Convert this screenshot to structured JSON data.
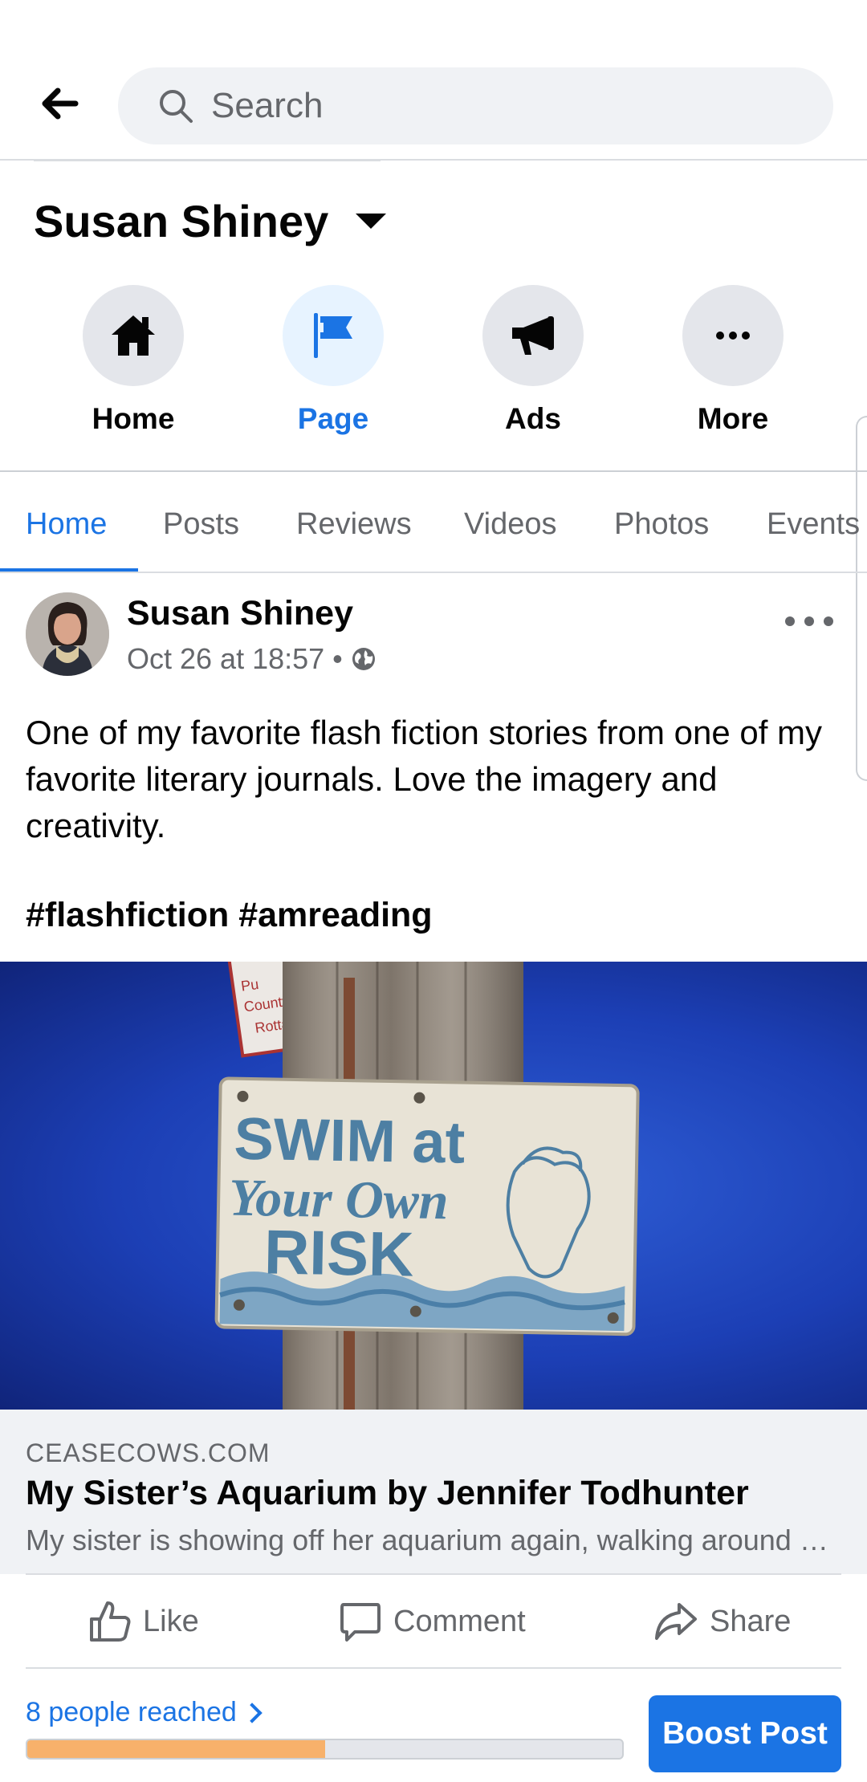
{
  "search": {
    "placeholder": "Search"
  },
  "page": {
    "title": "Susan Shiney"
  },
  "nav": [
    {
      "label": "Home",
      "icon": "home-icon",
      "active": false
    },
    {
      "label": "Page",
      "icon": "flag-icon",
      "active": true
    },
    {
      "label": "Ads",
      "icon": "megaphone-icon",
      "active": false
    },
    {
      "label": "More",
      "icon": "more-icon",
      "active": false
    }
  ],
  "tabs": [
    {
      "label": "Home",
      "active": true
    },
    {
      "label": "Posts"
    },
    {
      "label": "Reviews"
    },
    {
      "label": "Videos"
    },
    {
      "label": "Photos"
    },
    {
      "label": "Events"
    }
  ],
  "post": {
    "author": "Susan Shiney",
    "timestamp": "Oct 26 at 18:57",
    "separator": "•",
    "text": "One of my favorite flash fiction stories from one of my favorite literary journals. Love the imagery and creativity.",
    "hashtags": "#flashfiction #amreading",
    "image": {
      "sign_line1": "SWIM at",
      "sign_line2": "Your Own",
      "sign_line3": "RISK"
    },
    "link": {
      "domain": "CEASECOWS.COM",
      "title": "My Sister’s Aquarium by Jennifer Todhunter",
      "description": "My sister is showing off her aquarium again, walking around with it strapped to her head"
    }
  },
  "actions": {
    "like": "Like",
    "comment": "Comment",
    "share": "Share"
  },
  "footer": {
    "reach_text": "8 people reached",
    "reach_progress": 0.5,
    "boost_label": "Boost Post"
  },
  "colors": {
    "accent": "#1b74e4",
    "progress_fill": "#f7b16b",
    "image_sky": "#1c3fb5"
  }
}
